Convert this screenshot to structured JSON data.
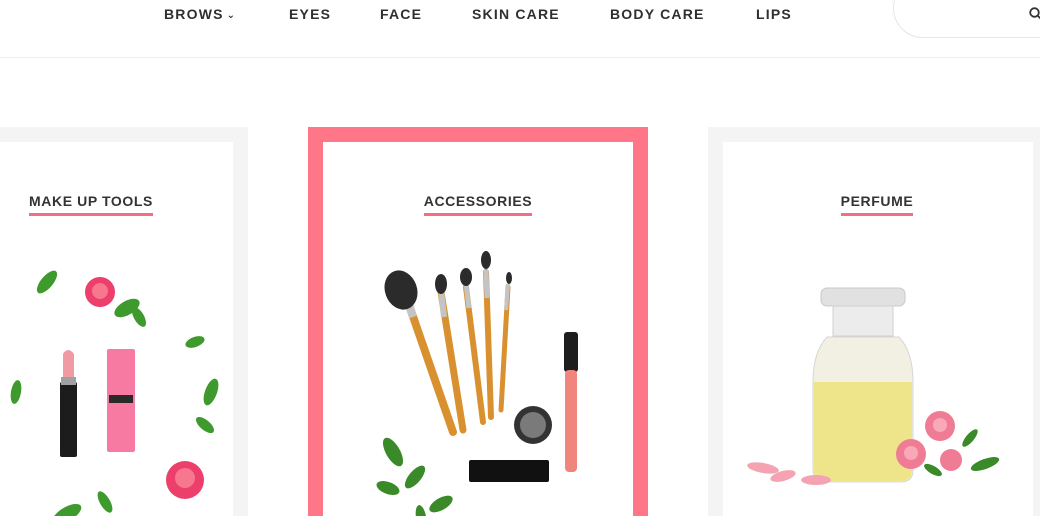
{
  "nav": {
    "items": [
      {
        "label": "BROWS",
        "has_dropdown": true
      },
      {
        "label": "EYES"
      },
      {
        "label": "FACE"
      },
      {
        "label": "SKIN CARE"
      },
      {
        "label": "BODY CARE"
      },
      {
        "label": "LIPS"
      }
    ],
    "dropdown_icon": "chevron-down-icon",
    "search": {
      "placeholder": "",
      "icon": "search-icon"
    }
  },
  "categories": [
    {
      "title": "MAKE UP TOOLS",
      "image": "lipstick-and-roses-illustration"
    },
    {
      "title": "ACCESSORIES",
      "image": "makeup-brushes-illustration",
      "active": true
    },
    {
      "title": "PERFUME",
      "image": "perfume-bottle-illustration"
    }
  ],
  "colors": {
    "accent": "#ff7689",
    "underline": "#f36d83",
    "card_bg": "#f4f4f4",
    "text": "#2f2f2f"
  }
}
